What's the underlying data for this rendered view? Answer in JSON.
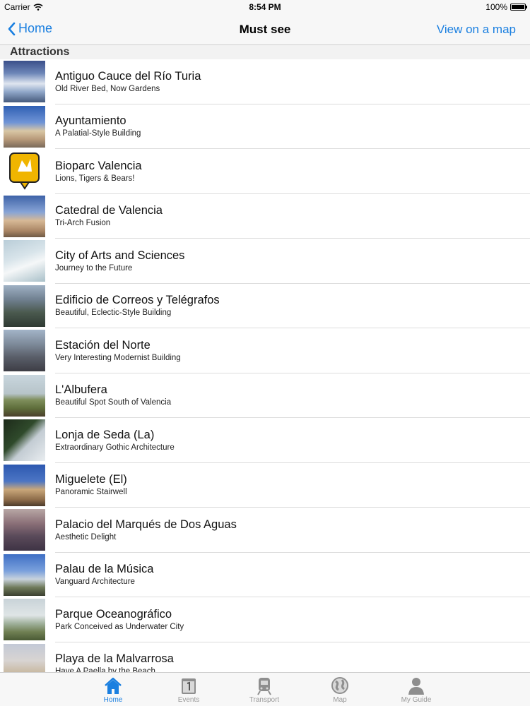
{
  "status": {
    "carrier": "Carrier",
    "time": "8:54 PM",
    "battery": "100%"
  },
  "nav": {
    "back_label": "Home",
    "title": "Must see",
    "map_label": "View on a map"
  },
  "section": {
    "header": "Attractions"
  },
  "attractions": [
    {
      "title": "Antiguo Cauce del Río Turia",
      "subtitle": "Old River Bed, Now Gardens"
    },
    {
      "title": "Ayuntamiento",
      "subtitle": "A Palatial-Style Building"
    },
    {
      "title": "Bioparc Valencia",
      "subtitle": "Lions, Tigers & Bears!"
    },
    {
      "title": "Catedral de Valencia",
      "subtitle": "Tri-Arch Fusion"
    },
    {
      "title": "City of Arts and Sciences",
      "subtitle": "Journey to the Future"
    },
    {
      "title": "Edificio de Correos y Telégrafos",
      "subtitle": "Beautiful, Eclectic-Style Building"
    },
    {
      "title": "Estación del Norte",
      "subtitle": "Very Interesting Modernist Building"
    },
    {
      "title": "L'Albufera",
      "subtitle": "Beautiful Spot South of Valencia"
    },
    {
      "title": "Lonja de Seda (La)",
      "subtitle": "Extraordinary Gothic Architecture"
    },
    {
      "title": "Miguelete (El)",
      "subtitle": "Panoramic Stairwell"
    },
    {
      "title": "Palacio del Marqués de Dos Aguas",
      "subtitle": "Aesthetic Delight"
    },
    {
      "title": "Palau de la Música",
      "subtitle": "Vanguard Architecture"
    },
    {
      "title": "Parque Oceanográfico",
      "subtitle": "Park Conceived as Underwater City"
    },
    {
      "title": "Playa de la Malvarrosa",
      "subtitle": "Have A Paella by the Beach"
    }
  ],
  "tabs": [
    {
      "label": "Home",
      "icon": "home-icon"
    },
    {
      "label": "Events",
      "icon": "calendar-icon"
    },
    {
      "label": "Transport",
      "icon": "train-icon"
    },
    {
      "label": "Map",
      "icon": "globe-icon"
    },
    {
      "label": "My Guide",
      "icon": "person-icon"
    }
  ],
  "colors": {
    "accent": "#1a7fe0",
    "inactive": "#999999",
    "bioparc_badge": "#f0b500"
  }
}
